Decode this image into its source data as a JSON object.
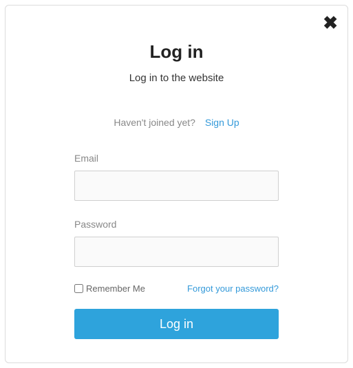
{
  "modal": {
    "title": "Log in",
    "subtitle": "Log in to the website",
    "prompt_text": "Haven't joined yet?",
    "signup_label": "Sign Up",
    "email_label": "Email",
    "email_value": "",
    "password_label": "Password",
    "password_value": "",
    "remember_label": "Remember Me",
    "forgot_label": "Forgot your password?",
    "login_button_label": "Log in"
  },
  "colors": {
    "accent": "#2ea3dc",
    "link": "#3399d9",
    "muted": "#888888",
    "text": "#222222"
  }
}
